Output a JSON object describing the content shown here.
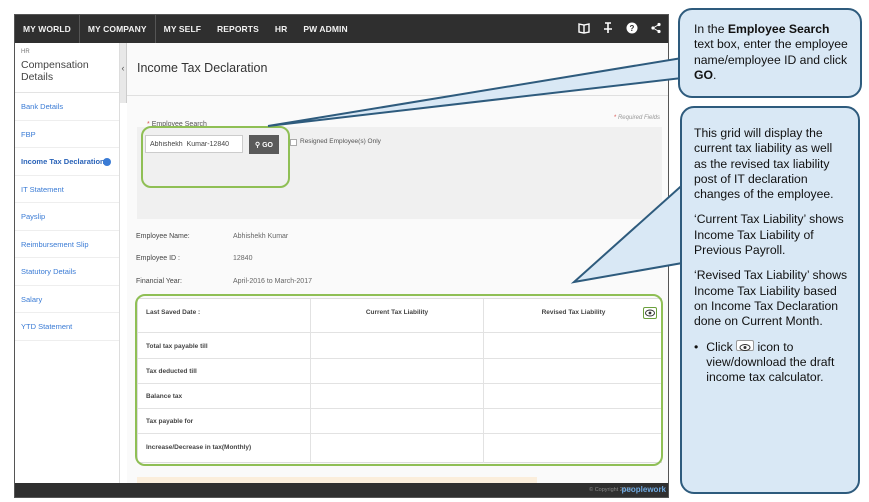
{
  "nav": {
    "items": [
      "MY WORLD",
      "MY COMPANY",
      "MY SELF",
      "REPORTS",
      "HR",
      "PW ADMIN"
    ],
    "icons": [
      "book-icon",
      "pin-icon",
      "help-icon",
      "share-icon"
    ]
  },
  "sidebar": {
    "section_small": "HR",
    "section_title": "Compensation Details",
    "items": [
      {
        "label": "Bank Details"
      },
      {
        "label": "FBP"
      },
      {
        "label": "Income Tax Declaration"
      },
      {
        "label": "IT Statement"
      },
      {
        "label": "Payslip"
      },
      {
        "label": "Reimbursement Slip"
      },
      {
        "label": "Statutory Details"
      },
      {
        "label": "Salary"
      },
      {
        "label": "YTD Statement"
      }
    ],
    "active_index": 2
  },
  "page": {
    "title": "Income Tax Declaration",
    "required_star": "*",
    "required_note": "Required Fields"
  },
  "search": {
    "star": "*",
    "label": "Employee Search",
    "value": "Abhishekh  Kumar-12840",
    "go_label": "GO",
    "go_icon": "search-icon",
    "resigned_label": "Resigned Employee(s) Only"
  },
  "employee": {
    "name_label": "Employee Name:",
    "name_value": "Abhishekh Kumar",
    "id_label": "Employee ID :",
    "id_value": "12840",
    "year_label": "Financial Year:",
    "year_value": "April-2016 to March-2017"
  },
  "grid": {
    "header": [
      "Last Saved Date :",
      "Current Tax Liability",
      "Revised Tax Liability"
    ],
    "rows": [
      "Total tax payable till",
      "Tax deducted till",
      "Balance tax",
      "Tax payable for",
      "Increase/Decrease in tax(Monthly)"
    ]
  },
  "footer": {
    "copyright": "© Copyright 2016",
    "brand": "peoplework"
  },
  "callout1": {
    "prefix": "In the ",
    "bold1": "Employee Search",
    "middle": " text box, enter the employee name/employee ID and click ",
    "bold2": "GO",
    "suffix": "."
  },
  "callout2": {
    "para1": "This grid will display the current tax liability as well as the revised tax liability post of IT declaration changes of the employee.",
    "para2": "‘Current Tax Liability’ shows Income Tax Liability of Previous Payroll.",
    "para3": "‘Revised Tax Liability’ shows Income Tax Liability based on Income Tax Declaration done on Current Month.",
    "bullet": "•",
    "bullet_pre": "Click",
    "bullet_post": "icon to view/download the draft income tax calculator."
  },
  "colors": {
    "nav_bg": "#2f2f2f",
    "highlight_ring": "#8fbf55",
    "callout_bg": "#d9e8f5",
    "callout_border": "#2e5b7d",
    "link": "#3a7bd5"
  }
}
